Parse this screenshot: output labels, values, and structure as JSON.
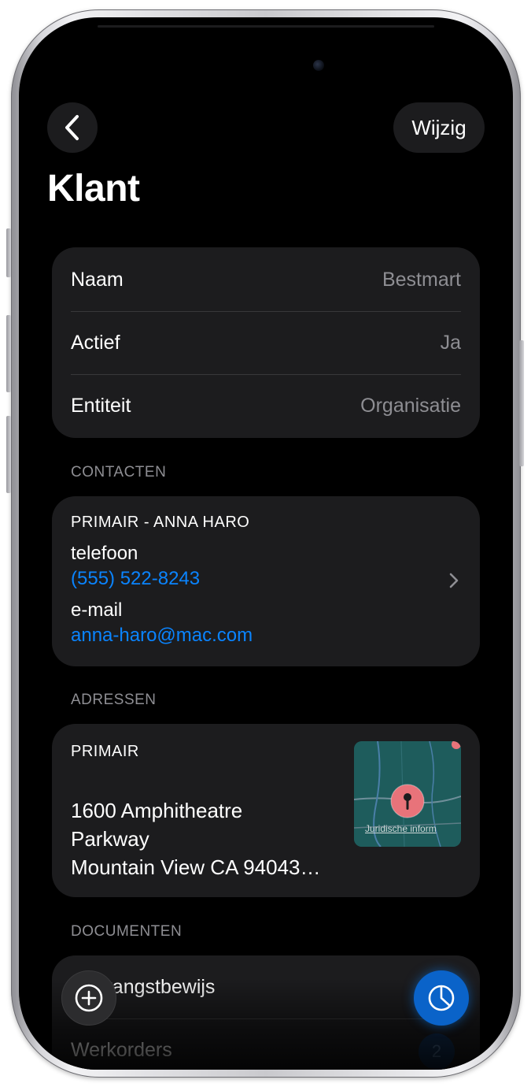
{
  "header": {
    "back_icon": "chevron-left-icon",
    "edit_label": "Wijzig"
  },
  "title": "Klant",
  "details": [
    {
      "label": "Naam",
      "value": "Bestmart"
    },
    {
      "label": "Actief",
      "value": "Ja"
    },
    {
      "label": "Entiteit",
      "value": "Organisatie"
    }
  ],
  "contacts": {
    "header": "CONTACTEN",
    "primary_label": "PRIMAIR - ANNA HARO",
    "phone_label": "telefoon",
    "phone_value": "(555) 522-8243",
    "email_label": "e-mail",
    "email_value": "anna-haro@mac.com",
    "chevron_icon": "chevron-right-icon"
  },
  "addresses": {
    "header": "ADRESSEN",
    "primary_label": "PRIMAIR",
    "line1": "1600 Amphitheatre",
    "line2": "Parkway",
    "line3": "Mountain View CA 94043…",
    "map_legal": "Juridische inform"
  },
  "documents": {
    "header": "DOCUMENTEN",
    "items": [
      {
        "label": "Ontvangstbewijs"
      },
      {
        "label": "Werkorders",
        "count": "2"
      }
    ]
  },
  "fabs": {
    "add_icon": "plus-circle-icon",
    "chart_icon": "pie-chart-icon"
  },
  "colors": {
    "accent": "#0a84ff",
    "card": "#1c1c1e",
    "background": "#000000",
    "secondary_text": "#8e8e93"
  }
}
